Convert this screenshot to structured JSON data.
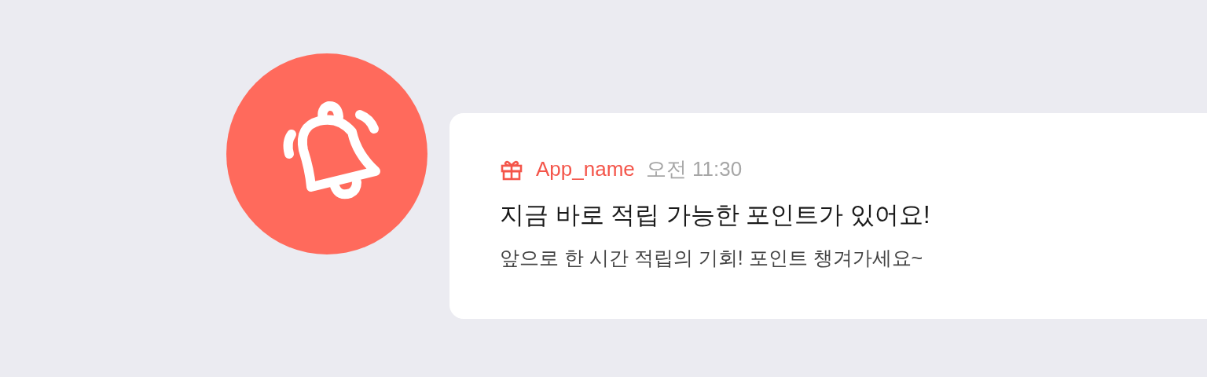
{
  "notification": {
    "app_name": "App_name",
    "time": "오전 11:30",
    "title": "지금 바로 적립 가능한 포인트가 있어요!",
    "message": "앞으로 한 시간 적립의 기회! 포인트 챙겨가세요~"
  }
}
